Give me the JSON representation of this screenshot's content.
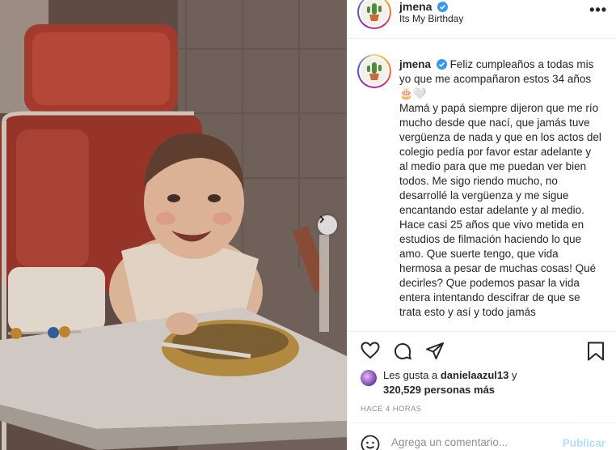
{
  "post": {
    "username": "jmena",
    "location": "Its My Birthday",
    "more_label": "•••",
    "photo_alt": "baby"
  },
  "caption": {
    "username": "jmena",
    "lines": [
      "Feliz cumpleaños a todas mis yo que me acompañaron estos 34 años 🎂🤍",
      "Mamá y papá siempre dijeron que me río mucho desde que nací, que jamás tuve vergüenza de nada y que en los actos del colegio pedía por favor estar adelante y al medio para que me puedan ver bien todos. Me sigo riendo mucho, no desarrollé la vergüenza y me sigue encantando estar adelante y al medio.",
      "Hace casi 25 años que vivo metida en estudios de filmación haciendo lo que amo. Que suerte tengo, que vida hermosa a pesar de muchas cosas! Qué decirles? Que podemos pasar la vida entera intentando descifrar de que se trata esto y así y todo jamás"
    ]
  },
  "likes": {
    "prefix": "Les gusta a",
    "user": "danielaazul13",
    "connector": "y",
    "count": "320,529 personas más"
  },
  "timestamp": "HACE 4 HORAS",
  "comment": {
    "placeholder": "Agrega un comentario...",
    "publish_label": "Publicar"
  },
  "icons": {
    "verified": "verified-badge-icon",
    "like": "heart-icon",
    "comment": "comment-icon",
    "share": "share-icon",
    "save": "bookmark-icon",
    "next": "chevron-right-icon",
    "emoji": "emoji-icon"
  },
  "colors": {
    "verified_blue": "#3897f0",
    "publish_disabled": "#b2dffc",
    "meta_gray": "#8e8e8e"
  }
}
